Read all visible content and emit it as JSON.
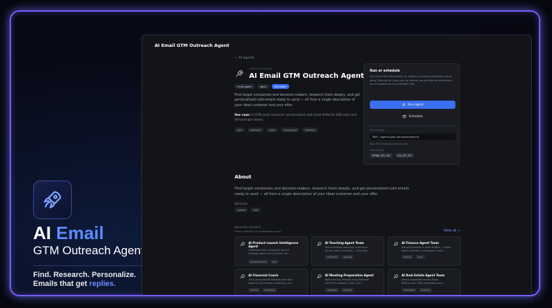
{
  "brand": {
    "title_plain": "AI ",
    "title_accent": "Email",
    "subtitle": "GTM Outreach Agent",
    "tagline_1": "Find. Research. Personalize.",
    "tagline_2_plain": "Emails that get ",
    "tagline_2_accent": "replies.",
    "icon": "rocket-icon",
    "accent_color": "#5b8cff"
  },
  "window": {
    "title": "AI Email GTM Outreach Agent"
  },
  "header": {
    "back_link": "← All agents",
    "eyebrow": "GTM-OUTREACH",
    "title": "AI Email GTM Outreach Agent",
    "badges": [
      {
        "label": "multi agent"
      },
      {
        "label": "agno"
      },
      {
        "label": "Runnable"
      }
    ],
    "description": "Find target companies and decision-makers, research them deeply, and get personalized cold emails ready to send — all from a single description of your ideal customer and your offer.",
    "use_case_label": "Use case:",
    "use_case_text": " AI GTM email outreach—personalized cold email drafts for B2B sales and demand-gen teams.",
    "tags": [
      "gtm",
      "outreach",
      "sales",
      "multi-agent",
      "addlavin"
    ]
  },
  "run_panel": {
    "heading": "Run or schedule",
    "text": "Run once from the wizard, or create a recurring schedule (cloud plan). Manual-run keys are not stored; server-side schedule keys are encrypted on the schedule row.",
    "run_label": "Run agent",
    "schedule_label": "Schedule",
    "api_label": "API endpoint",
    "api_code": "POST /agents/gtm-outreach/execute",
    "base_url": "Base URL https://api.example.com",
    "keys_label": "Typical keys",
    "keys": [
      "OPENAI_API_KEY",
      "EXA_API_KEY"
    ]
  },
  "about": {
    "heading": "About",
    "text": "Find target companies and decision-makers, research them deeply, and get personalized cold emails ready to send — all from a single description of your ideal customer and your offer.",
    "services_label": "Services",
    "services": [
      "openai",
      "exa"
    ]
  },
  "related": {
    "label": "RELATED AGENTS",
    "subtitle": "Same category or overlapping tags.",
    "view_all": "View all →",
    "cards": [
      {
        "title": "AI Product Launch Intelligence Agent",
        "desc": [
          "Understand any company's launch",
          "strategy faster than a human can ..."
        ],
        "tags": [
          "product-launch",
          "gtm"
        ]
      },
      {
        "title": "AI Teaching Agent Team",
        "desc": [
          "Get a personal self-study curriculum",
          "on any topic in minutes — including ..."
        ],
        "tags": [
          "education",
          "learning"
        ]
      },
      {
        "title": "AI Finance Agent Team",
        "desc": [
          "Ask one question in plain English — about",
          "stocks, markets, or economic news ..."
        ],
        "tags": [
          "finance",
          "team"
        ]
      },
      {
        "title": "AI Financial Coach",
        "desc": [
          "Get a personalized financial plan that",
          "looks at your income, expenses, and ..."
        ],
        "tags": [
          "finance",
          "budgeting"
        ]
      },
      {
        "title": "AI Meeting Preparation Agent",
        "desc": [
          "Walk into any meeting fully prepared.",
          "Enter the company name, your ..."
        ],
        "tags": [
          "meetings",
          "research"
        ]
      },
      {
        "title": "AI Real Estate Agent Team",
        "desc": [
          "Search properties across Zillow,",
          "Realtor.com, Trulia and Redfin.com ..."
        ],
        "tags": [
          "real-estate",
          "property"
        ]
      }
    ]
  }
}
